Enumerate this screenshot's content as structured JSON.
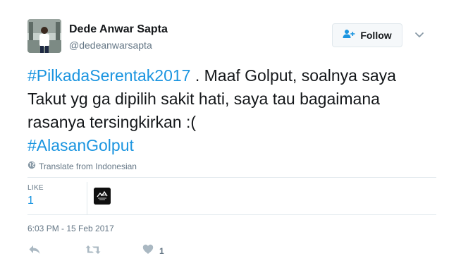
{
  "author": {
    "name": "Dede Anwar Sapta",
    "handle": "@dedeanwarsapta"
  },
  "follow_button": {
    "label": "Follow"
  },
  "tweet": {
    "hashtag_1": "#PilkadaSerentak2017",
    "text": " . Maaf Golput, soalnya saya Takut yg ga dipilih sakit hati, saya tau bagaimana rasanya tersingkirkan :(",
    "hashtag_2": "#AlasanGolput"
  },
  "translate": {
    "label": "Translate from Indonesian"
  },
  "stats": {
    "like_label": "LIKE",
    "like_count": "1"
  },
  "timestamp": "6:03 PM - 15 Feb 2017",
  "actions": {
    "like_count": "1"
  },
  "colors": {
    "link": "#1b95e0",
    "muted": "#657786",
    "text": "#14171a",
    "border": "#e1e8ed"
  },
  "icons": [
    "avatar",
    "add-user-icon",
    "chevron-down-icon",
    "globe-icon",
    "reply-icon",
    "retweet-icon",
    "heart-icon"
  ]
}
